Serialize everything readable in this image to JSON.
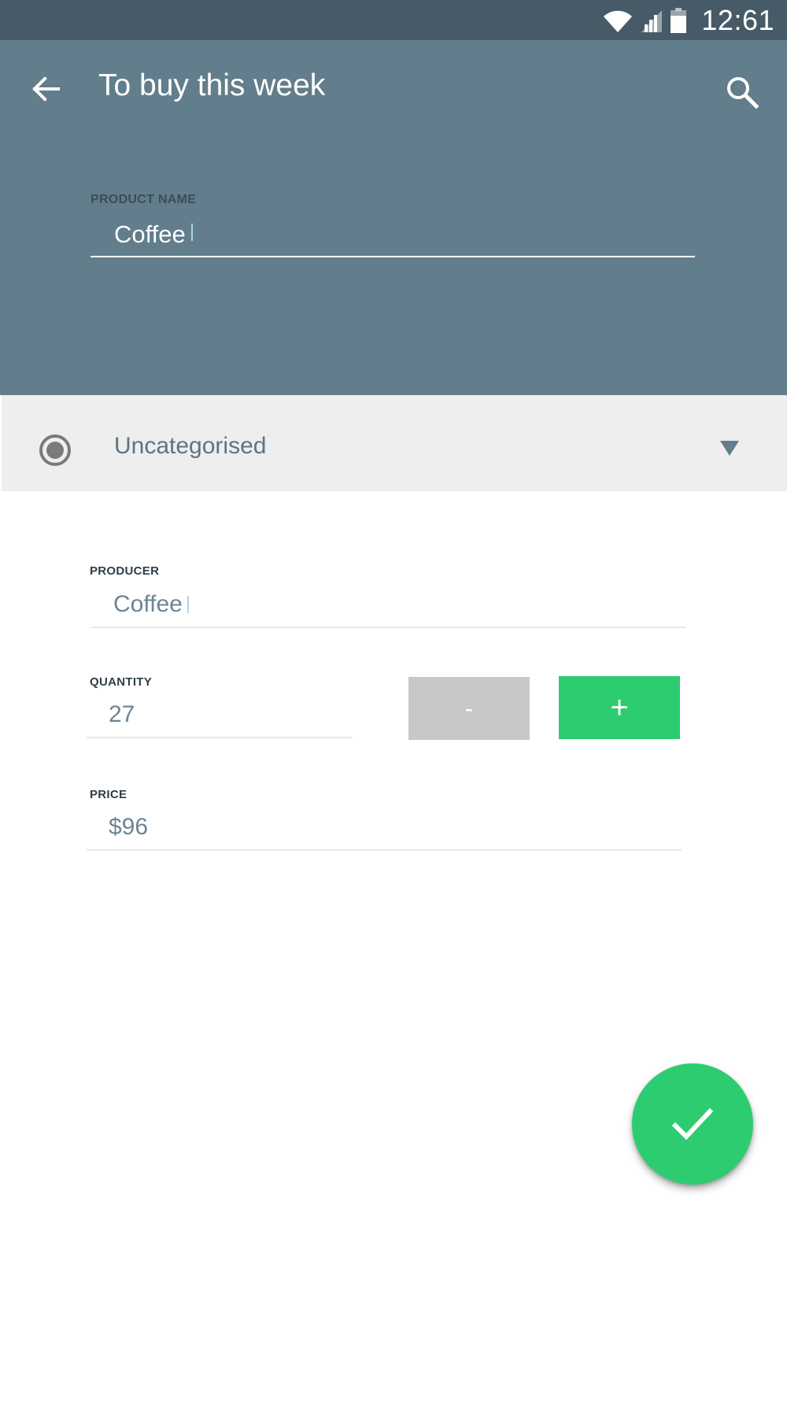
{
  "status_bar": {
    "time": "12:61"
  },
  "app_bar": {
    "title": "To buy this week"
  },
  "product_name": {
    "label": "PRODUCT NAME",
    "value": "Coffee"
  },
  "category": {
    "label": "Uncategorised"
  },
  "producer": {
    "label": "PRODUCER",
    "value": "Coffee"
  },
  "quantity": {
    "label": "QUANTITY",
    "value": "27",
    "minus_label": "-",
    "plus_label": "+"
  },
  "price": {
    "label": "PRICE",
    "value": "$96"
  },
  "icons": {
    "back": "arrow-back-icon",
    "search": "search-icon",
    "category": "radio-icon",
    "dropdown": "dropdown-triangle-icon",
    "confirm": "check-icon"
  },
  "colors": {
    "status_bar": "#465a67",
    "header": "#627d8b",
    "accent": "#2ecc71",
    "category_bg": "#eeeeee"
  }
}
